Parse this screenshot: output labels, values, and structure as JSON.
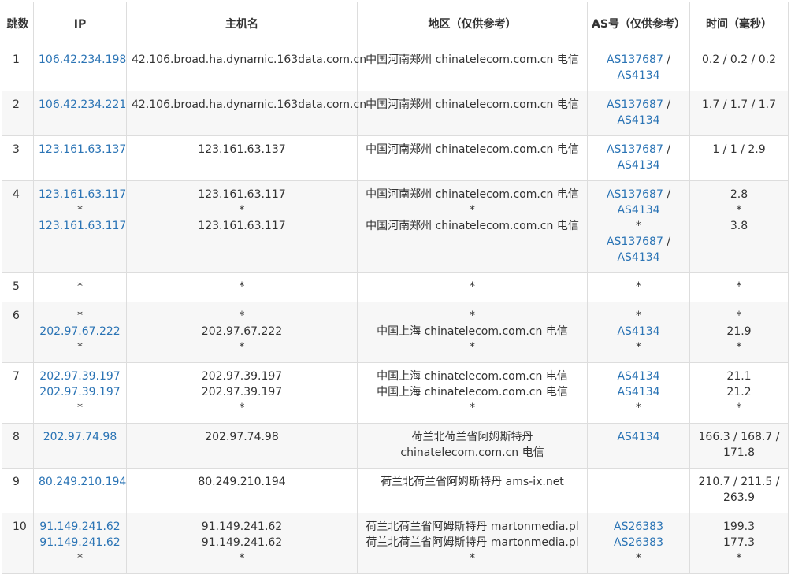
{
  "headers": {
    "hop": "跳数",
    "ip": "IP",
    "host": "主机名",
    "region": "地区（仅供参考）",
    "asn": "AS号（仅供参考）",
    "time": "时间（毫秒）"
  },
  "rows": [
    {
      "hop": "1",
      "ip": [
        "106.42.234.198"
      ],
      "host": [
        "42.106.broad.ha.dynamic.163data.com.cn"
      ],
      "host_left": true,
      "region": [
        "中国河南郑州 chinatelecom.com.cn 电信"
      ],
      "asn": [
        [
          "AS137687",
          "AS4134"
        ]
      ],
      "time": [
        "0.2 / 0.2 / 0.2"
      ]
    },
    {
      "hop": "2",
      "ip": [
        "106.42.234.221"
      ],
      "host": [
        "42.106.broad.ha.dynamic.163data.com.cn"
      ],
      "host_left": true,
      "region": [
        "中国河南郑州 chinatelecom.com.cn 电信"
      ],
      "asn": [
        [
          "AS137687",
          "AS4134"
        ]
      ],
      "time": [
        "1.7 / 1.7 / 1.7"
      ]
    },
    {
      "hop": "3",
      "ip": [
        "123.161.63.137"
      ],
      "host": [
        "123.161.63.137"
      ],
      "region": [
        "中国河南郑州 chinatelecom.com.cn 电信"
      ],
      "asn": [
        [
          "AS137687",
          "AS4134"
        ]
      ],
      "time": [
        "1 / 1 / 2.9"
      ]
    },
    {
      "hop": "4",
      "ip": [
        "123.161.63.117",
        "*",
        "123.161.63.117"
      ],
      "host": [
        "123.161.63.117",
        "*",
        "123.161.63.117"
      ],
      "region": [
        "中国河南郑州 chinatelecom.com.cn 电信",
        "*",
        "中国河南郑州 chinatelecom.com.cn 电信"
      ],
      "asn": [
        [
          "AS137687",
          "AS4134"
        ],
        "*",
        [
          "AS137687",
          "AS4134"
        ]
      ],
      "time": [
        "2.8",
        "*",
        "3.8"
      ]
    },
    {
      "hop": "5",
      "ip": [
        "*"
      ],
      "host": [
        "*"
      ],
      "region": [
        "*"
      ],
      "asn": [
        "*"
      ],
      "time": [
        "*"
      ]
    },
    {
      "hop": "6",
      "ip": [
        "*",
        "202.97.67.222",
        "*"
      ],
      "host": [
        "*",
        "202.97.67.222",
        "*"
      ],
      "region": [
        "*",
        "中国上海 chinatelecom.com.cn 电信",
        "*"
      ],
      "asn": [
        "*",
        [
          "AS4134"
        ],
        "*"
      ],
      "time": [
        "*",
        "21.9",
        "*"
      ]
    },
    {
      "hop": "7",
      "ip": [
        "202.97.39.197",
        "202.97.39.197",
        "*"
      ],
      "host": [
        "202.97.39.197",
        "202.97.39.197",
        "*"
      ],
      "region": [
        "中国上海 chinatelecom.com.cn 电信",
        "中国上海 chinatelecom.com.cn 电信",
        "*"
      ],
      "asn": [
        [
          "AS4134"
        ],
        [
          "AS4134"
        ],
        "*"
      ],
      "time": [
        "21.1",
        "21.2",
        "*"
      ]
    },
    {
      "hop": "8",
      "ip": [
        "202.97.74.98"
      ],
      "host": [
        "202.97.74.98"
      ],
      "region": [
        "荷兰北荷兰省阿姆斯特丹",
        "chinatelecom.com.cn 电信"
      ],
      "asn": [
        [
          "AS4134"
        ]
      ],
      "time": [
        "166.3 / 168.7 /",
        "171.8"
      ]
    },
    {
      "hop": "9",
      "ip": [
        "80.249.210.194"
      ],
      "host": [
        "80.249.210.194"
      ],
      "region": [
        "荷兰北荷兰省阿姆斯特丹 ams-ix.net"
      ],
      "asn": [],
      "time": [
        "210.7 / 211.5 /",
        "263.9"
      ]
    },
    {
      "hop": "10",
      "ip": [
        "91.149.241.62",
        "91.149.241.62",
        "*"
      ],
      "host": [
        "91.149.241.62",
        "91.149.241.62",
        "*"
      ],
      "region": [
        "荷兰北荷兰省阿姆斯特丹 martonmedia.pl",
        "荷兰北荷兰省阿姆斯特丹 martonmedia.pl",
        "*"
      ],
      "asn": [
        [
          "AS26383"
        ],
        [
          "AS26383"
        ],
        "*"
      ],
      "time": [
        "199.3",
        "177.3",
        "*"
      ]
    }
  ],
  "colors": {
    "link": "#2b74b5",
    "border": "#dddddd",
    "stripe": "#f7f7f7"
  }
}
